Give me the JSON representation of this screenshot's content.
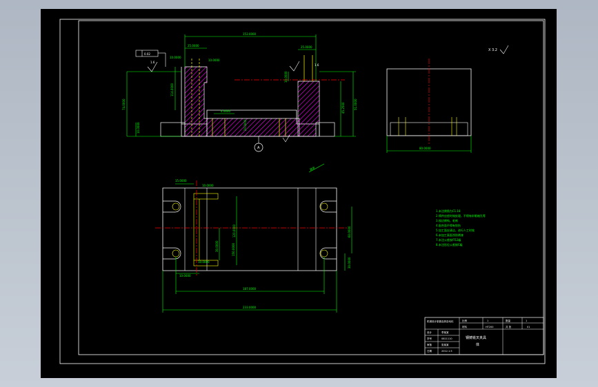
{
  "colors": {
    "background": "#000000",
    "frame": "#ffffff",
    "part_outline": "#ffffff",
    "dimensions": "#00ff00",
    "centerline": "#ff0000",
    "hatch": "#ff00ff",
    "hidden_line": "#ffff00"
  },
  "front_view": {
    "dim_top_width": "153.0000",
    "dim_left_boss_width": "25.0000",
    "dim_left_boss_small": "10.0000",
    "dim_left_gap": "10.0000",
    "dim_right_boss": "25.0000",
    "dim_left_height": "114.0000",
    "dim_overall_height": "74.0000",
    "dim_small_height": "10.0000",
    "dim_slot": "4.0000",
    "dim_bottom": "20.0000",
    "dim_right_inner": "10.0000",
    "dim_right_height1": "45.2500",
    "dim_right_height2": "51.0000",
    "dim_base": "10.0000",
    "section_label": "A",
    "roughness_label_left": "1.6",
    "roughness_label_right": "1.6",
    "tolerance_box": "0.02"
  },
  "side_view": {
    "dim_width": "80.0000"
  },
  "top_view": {
    "dim_left_top": "15.0000",
    "dim_left_top2": "10.0000",
    "dim_center_height": "120.0000",
    "dim_right_height": "60.0000",
    "dim_inner_height": "30.0000",
    "dim_inner_small": "150.0000",
    "dim_right_small": "30.0000",
    "dim_bottom_small": "10.0000",
    "dim_bottom_small2": "10.0000",
    "dim_inner_width": "187.0000",
    "dim_overall_width": "233.0000",
    "angle_label": "其余"
  },
  "roughness_symbol_top_right": "X 3.2",
  "notes": {
    "items": [
      "1.未注倒角为C1.18",
      "2.铸件应经时效处理，不得有砂眼缩孔等",
      "3.锐边倒钝，毛刺",
      "4.配合面不得有划伤",
      "5.加工面应清洁，进行人工时效",
      "6.未加工表面涂防锈漆",
      "7.未注公差按IT12级",
      "8.未注形位公差按C级"
    ]
  },
  "title_block": {
    "school": "机械设计制造及其自动化",
    "label_proportion": "比例",
    "value_proportion": "1",
    "label_material": "材料",
    "value_material": "HT200",
    "label_quantity": "数量",
    "value_quantity": "1",
    "label_sheet": "共 张",
    "label_sheet_of": "第 张",
    "label_designer": "设计",
    "value_designer": "李某某",
    "label_checker": "审核",
    "value_checker": "张某某",
    "label_number": "学号",
    "value_number": "0811110",
    "label_date": "日期",
    "value_date": "2012.1.5",
    "part_name": "钢铸铣叉夹具",
    "part_name2": "体",
    "drawing_number": "01"
  }
}
